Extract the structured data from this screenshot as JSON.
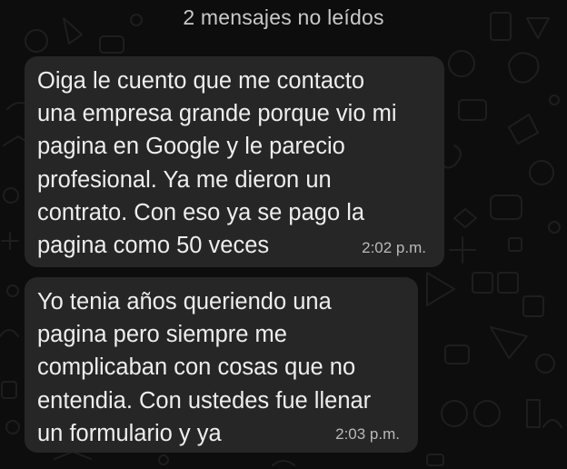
{
  "unread_banner": "2 mensajes no leídos",
  "messages": [
    {
      "text": "Oiga le cuento que me contacto\nuna empresa grande porque vio mi\npagina en Google y le parecio\nprofesional. Ya me dieron un\ncontrato. Con eso ya se pago la\npagina como 50 veces",
      "time": "2:02 p.m."
    },
    {
      "text": "Yo tenia años queriendo una\npagina pero siempre me\ncomplicaban con cosas que no\nentendia. Con ustedes fue llenar\nun formulario y ya",
      "time": "2:03 p.m."
    }
  ],
  "colors": {
    "background": "#0d0d0d",
    "bubble": "#262626",
    "text": "#eeeeee",
    "timestamp": "#b9b9b9",
    "banner_text": "#c9c9c9"
  }
}
